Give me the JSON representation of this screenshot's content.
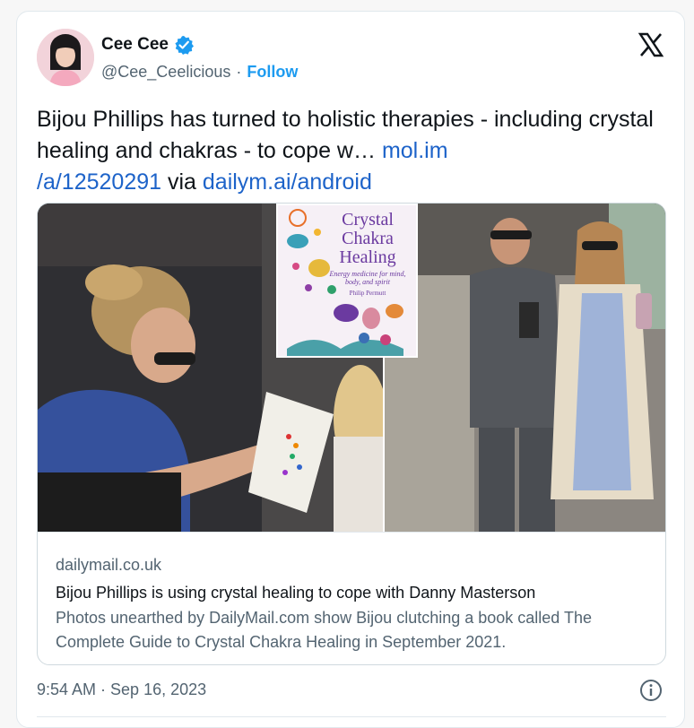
{
  "user": {
    "display_name": "Cee Cee",
    "handle": "@Cee_Ceelicious",
    "separator": "·",
    "follow_label": "Follow"
  },
  "tweet": {
    "text_plain": "Bijou Phillips has turned to holistic therapies - including crystal healing and chakras - to cope w… ",
    "link1": "mol.im\n/a/12520291",
    "via": " via ",
    "link2": "dailym.ai/android"
  },
  "media": {
    "book_title": "Crystal Chakra Healing",
    "book_subtitle": "Energy medicine for mind, body, and spirit",
    "book_author": "Philip Permutt"
  },
  "link_card": {
    "domain": "dailymail.co.uk",
    "title": "Bijou Phillips is using crystal healing to cope with Danny Masterson",
    "description": "Photos unearthed by DailyMail.com show Bijou clutching a book called The Complete Guide to Crystal Chakra Healing in September 2021."
  },
  "footer": {
    "timestamp": "9:54 AM · Sep 16, 2023"
  },
  "icons": {
    "verified": "verified-badge-icon",
    "brand": "x-logo-icon",
    "info": "info-icon"
  },
  "colors": {
    "link_blue": "#1d9bf0",
    "text": "#0f1419",
    "muted": "#536471"
  }
}
